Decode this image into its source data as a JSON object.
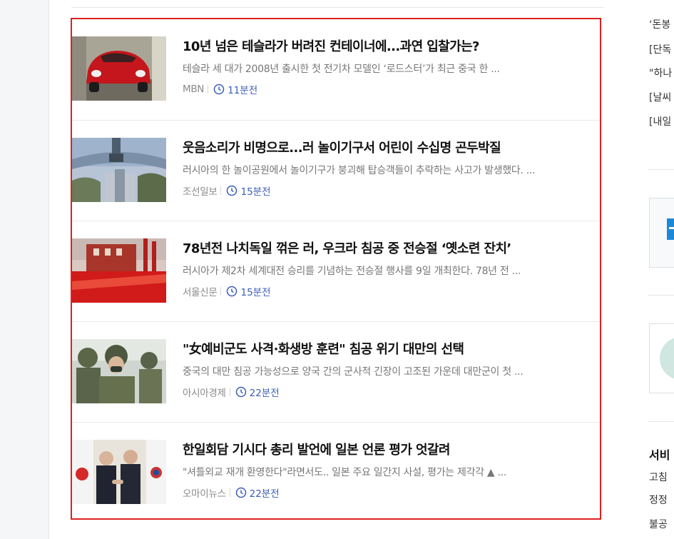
{
  "news": [
    {
      "title": "10년 넘은 테슬라가 버려진 컨테이너에...과연 입찰가는?",
      "desc": "테슬라 세 대가 2008년 출시한 첫 전기차 모델인 ‘로드스터’가 최근 중국 한 ...",
      "press": "MBN",
      "time": "11분전",
      "thumb_icon": "red-car-photo"
    },
    {
      "title": "웃음소리가 비명으로...러 놀이기구서 어린이 수십명 곤두박질",
      "desc": "러시아의 한 놀이공원에서 놀이기구가 붕괴해 탑승객들이 추락하는 사고가 발생했다. ...",
      "press": "조선일보",
      "time": "15분전",
      "thumb_icon": "amusement-ride-photo"
    },
    {
      "title": "78년전 나치독일 꺾은 러, 우크라 침공 중 전승절 ‘옛소련 잔치’",
      "desc": "러시아가 제2차 세계대전 승리를 기념하는 전승절 행사를 9일 개최한다. 78년 전 ...",
      "press": "서울신문",
      "time": "15분전",
      "thumb_icon": "red-square-photo"
    },
    {
      "title": "\"女예비군도 사격·화생방 훈련\" 침공 위기 대만의 선택",
      "desc": "중국의 대만 침공 가능성으로 양국 간의 군사적 긴장이 고조된 가운데 대만군이 첫 ...",
      "press": "아시아경제",
      "time": "22분전",
      "thumb_icon": "soldiers-photo"
    },
    {
      "title": "한일회담 기시다 총리 발언에 일본 언론 평가 엇갈려",
      "desc": "\"셔틀외교 재개 환영한다\"라면서도.. 일본 주요 일간지 사설, 평가는 제각각 ▲ ...",
      "press": "오마이뉴스",
      "time": "22분전",
      "thumb_icon": "summit-handshake-photo"
    }
  ],
  "sidebar": {
    "links": [
      "‘돈봉",
      "[단독",
      "\"하나",
      "[날씨",
      "[내일"
    ],
    "heading": "서비",
    "bottom_links": [
      "고침",
      "정정",
      "불공"
    ]
  },
  "colors": {
    "highlight_border": "#e02020",
    "time_blue": "#3a5eb8",
    "desc_gray": "#777777"
  }
}
